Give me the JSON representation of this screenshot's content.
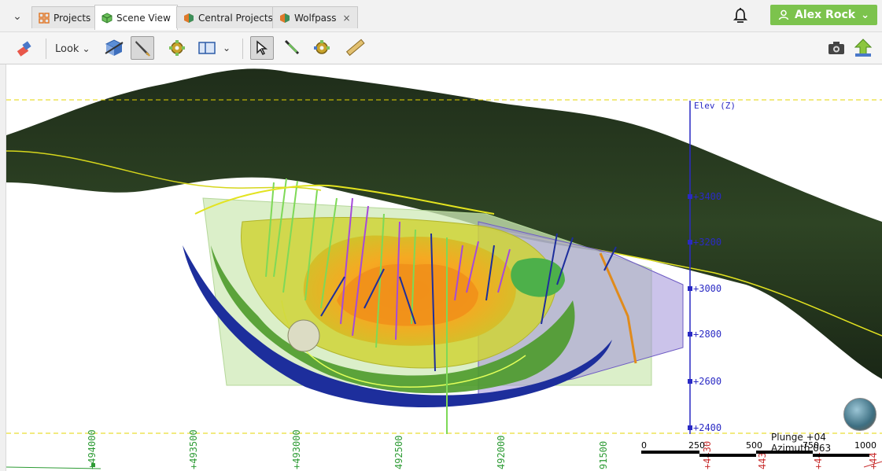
{
  "tabs": [
    {
      "label": "Projects",
      "icon": "grid-icon",
      "color": "#e0792a"
    },
    {
      "label": "Scene View",
      "icon": "cube-icon",
      "color": "#4caf50",
      "active": true
    },
    {
      "label": "Central Projects",
      "icon": "hex-icon",
      "color": "#3d8f5a"
    },
    {
      "label": "Wolfpass",
      "icon": "hex-icon",
      "color": "#3d8f5a",
      "close": "×"
    }
  ],
  "user": {
    "name": "Alex Rock",
    "icon": "user-icon",
    "color": "#7cc34d"
  },
  "toolbar": {
    "look_label": "Look"
  },
  "scene": {
    "axis_label": "Elev (Z)",
    "elevations": [
      "+3400",
      "+3200",
      "+3000",
      "+2800",
      "+2600",
      "+2400"
    ],
    "eastings": [
      "+494000",
      "+493500",
      "+493000",
      "492500",
      "492000",
      "91500"
    ],
    "northing_fragments": [
      "+4430",
      "443",
      "+44",
      "+44"
    ]
  },
  "orientation": {
    "plunge_label": "Plunge +04",
    "azimuth_label": "Azimuth 063"
  },
  "scalebar": {
    "labels": [
      "0",
      "250",
      "500",
      "750",
      "1000"
    ]
  }
}
